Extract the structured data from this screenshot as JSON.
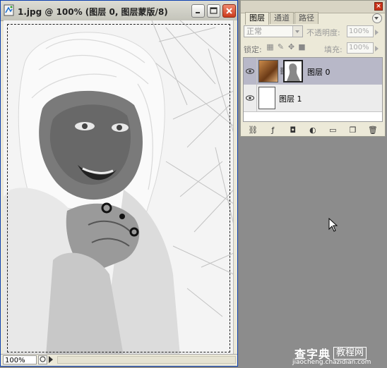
{
  "document": {
    "title": "1.jpg @ 100% (图层 0, 图层蒙版/8)",
    "zoom": "100%"
  },
  "layers_panel": {
    "tabs": [
      "图层",
      "通道",
      "路径"
    ],
    "active_tab": 0,
    "blend_mode": "正常",
    "opacity_label": "不透明度:",
    "opacity_value": "100%",
    "lock_label": "锁定:",
    "fill_label": "填充:",
    "fill_value": "100%",
    "layers": [
      {
        "name": "图层 0",
        "selected": true,
        "has_mask": true
      },
      {
        "name": "图层 1",
        "selected": false,
        "has_mask": false
      }
    ]
  },
  "watermark": {
    "brand": "查字典",
    "boxed": "教程网",
    "url": "jiaocheng.chazidian.com"
  }
}
